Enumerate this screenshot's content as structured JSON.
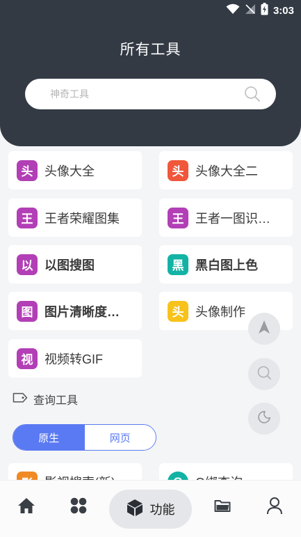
{
  "status_bar": {
    "time": "3:03"
  },
  "header": {
    "title": "所有工具"
  },
  "search": {
    "placeholder": "神奇工具"
  },
  "tools": [
    {
      "badge": "头",
      "label": "头像大全",
      "color": "#b23fb6"
    },
    {
      "badge": "头",
      "label": "头像大全二",
      "color": "#f0573b"
    },
    {
      "badge": "王",
      "label": "王者荣耀图集",
      "color": "#b23fb6"
    },
    {
      "badge": "王",
      "label": "王者一图识…",
      "color": "#b23fb6"
    },
    {
      "badge": "以",
      "label": "以图搜图",
      "color": "#b23fb6"
    },
    {
      "badge": "黑",
      "label": "黑白图上色",
      "color": "#12b3a4"
    },
    {
      "badge": "图",
      "label": "图片清晰度…",
      "color": "#b23fb6"
    },
    {
      "badge": "头",
      "label": "头像制作",
      "color": "#f7c21b"
    },
    {
      "badge": "视",
      "label": "视频转GIF",
      "color": "#b23fb6"
    }
  ],
  "section": {
    "title": "查询工具"
  },
  "segment": {
    "native_label": "原生",
    "web_label": "网页"
  },
  "peek_items": [
    {
      "badge": "影",
      "label": "影视搜索(新)",
      "color": "#f08a24"
    },
    {
      "badge": "Q",
      "label": "Q绑查询",
      "color": "#12b3a4"
    }
  ],
  "bottom_nav": {
    "active_label": "功能"
  },
  "colors": {
    "header_bg": "#333a44",
    "accent": "#5a7af3",
    "page_bg": "#f4f5f7"
  }
}
